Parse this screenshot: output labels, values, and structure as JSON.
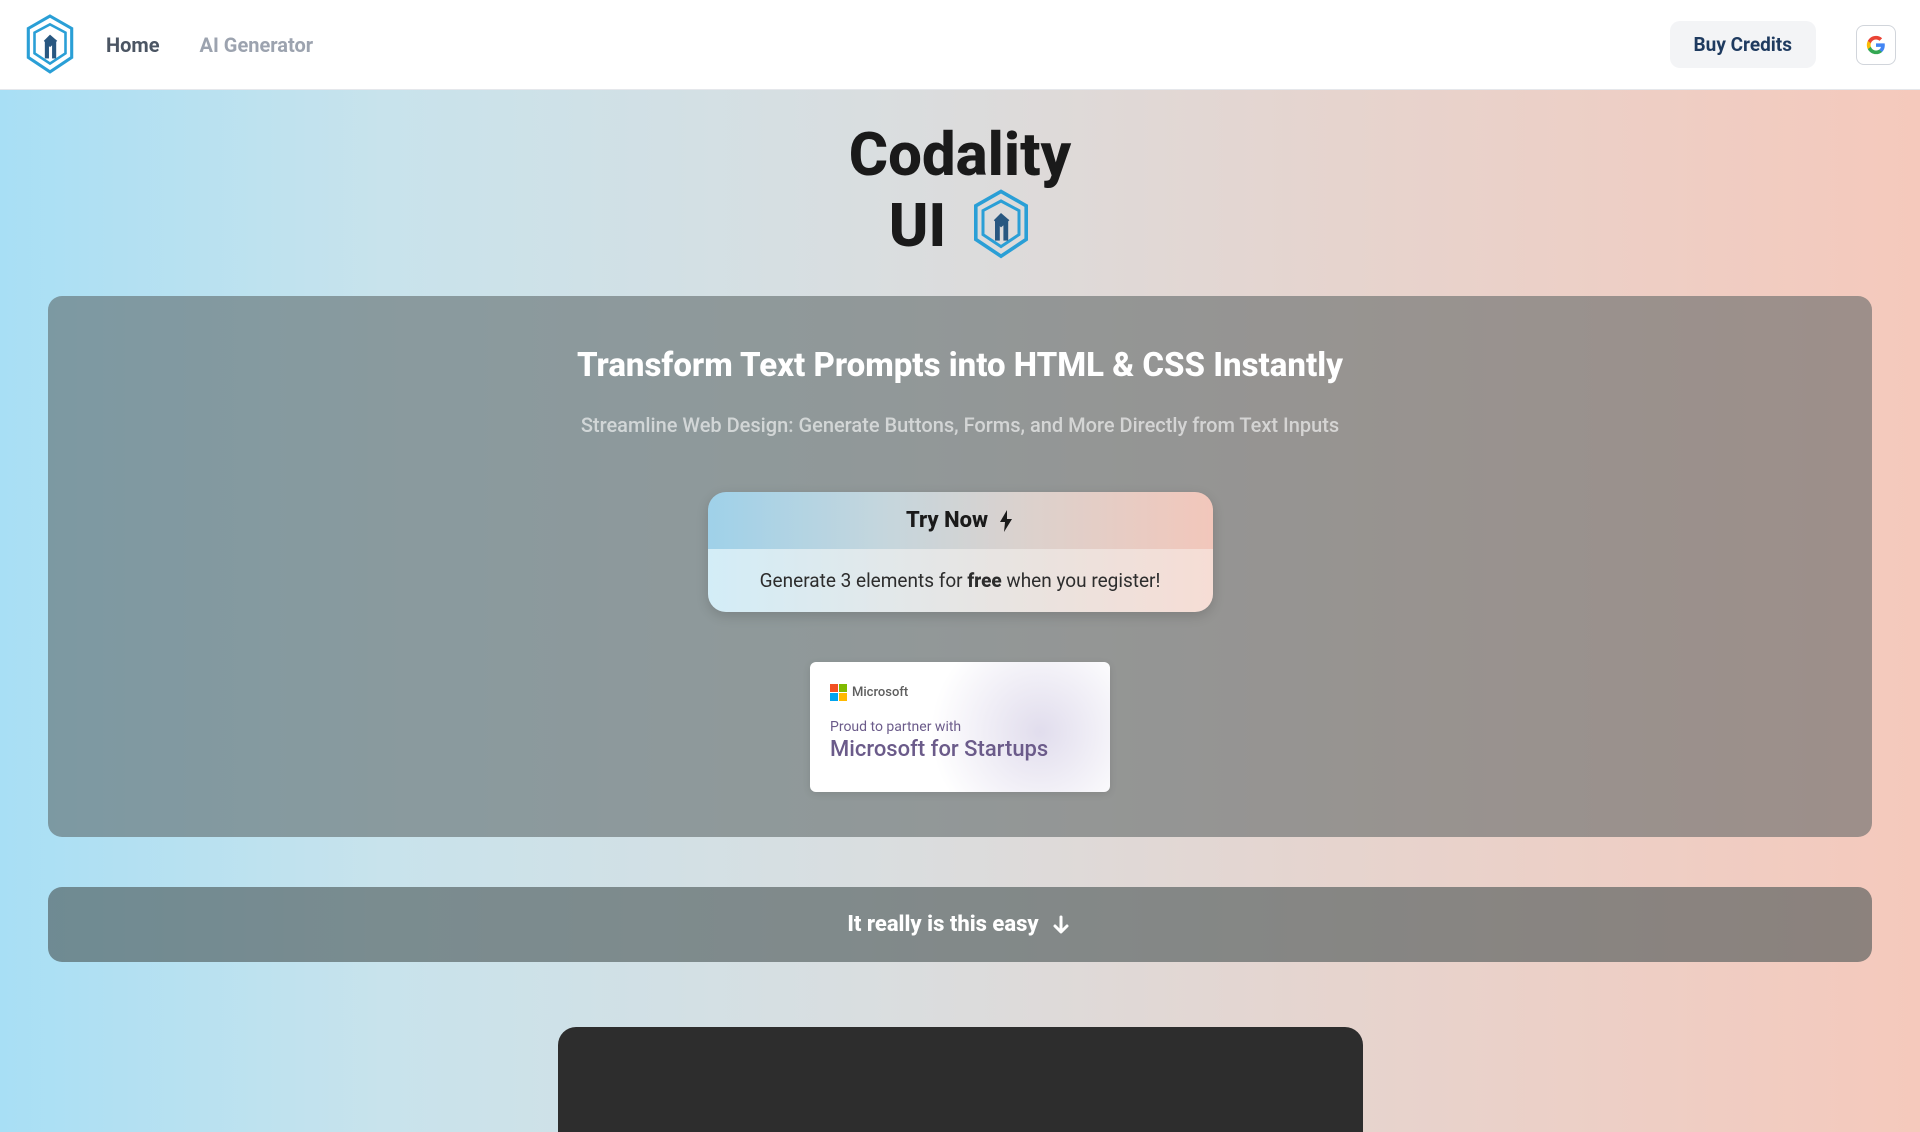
{
  "header": {
    "nav": [
      {
        "label": "Home",
        "active": true
      },
      {
        "label": "AI Generator",
        "active": false
      }
    ],
    "buy_credits_label": "Buy Credits"
  },
  "hero": {
    "title_line1": "Codality",
    "title_line2": "UI"
  },
  "card": {
    "heading": "Transform Text Prompts into HTML & CSS Instantly",
    "subheading": "Streamline Web Design: Generate Buttons, Forms, and More Directly from Text Inputs",
    "try_now_label": "Try Now",
    "try_now_promo_prefix": "Generate 3 elements for ",
    "try_now_promo_free": "free",
    "try_now_promo_suffix": " when you register!"
  },
  "ms_partner": {
    "brand": "Microsoft",
    "line1": "Proud to partner with",
    "line2": "Microsoft for Startups"
  },
  "easy_banner": {
    "text": "It really is this easy"
  }
}
